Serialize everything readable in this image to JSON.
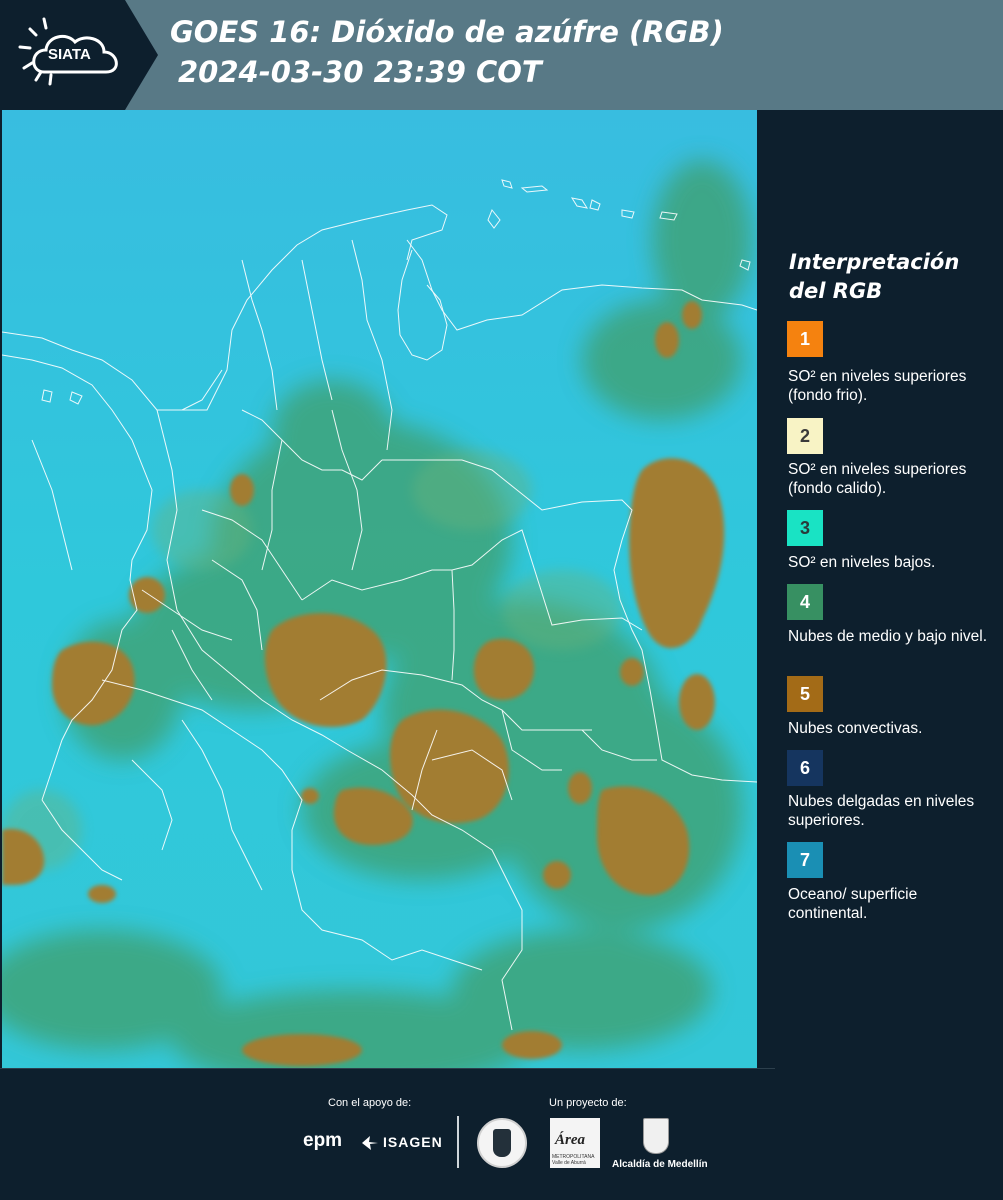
{
  "header": {
    "logo_text": "SIATA",
    "title": "GOES 16: Dióxido de azúfre (RGB)",
    "subtitle": "2024-03-30 23:39 COT"
  },
  "legend": {
    "title": "Interpretación del RGB",
    "items": [
      {
        "number": "1",
        "label": "SO² en niveles superiores (fondo frio).",
        "color": "#f5820f",
        "text_color": "#ffffff"
      },
      {
        "number": "2",
        "label": "SO² en niveles superiores (fondo calido).",
        "color": "#f8f3c5",
        "text_color": "#3a3a3a"
      },
      {
        "number": "3",
        "label": "SO² en niveles bajos.",
        "color": "#19e3c4",
        "text_color": "#2a3a3a"
      },
      {
        "number": "4",
        "label": "Nubes de medio y bajo nivel.",
        "color": "#379062",
        "text_color": "#ffffff"
      },
      {
        "number": "5",
        "label": "Nubes convectivas.",
        "color": "#a36b17",
        "text_color": "#ffffff"
      },
      {
        "number": "6",
        "label": "Nubes delgadas en niveles superiores.",
        "color": "#15355f",
        "text_color": "#ffffff"
      },
      {
        "number": "7",
        "label": "Oceano/ superficie continental.",
        "color": "#1a8fb4",
        "text_color": "#ffffff"
      }
    ]
  },
  "footer": {
    "support_label": "Con el apoyo de:",
    "support_logos": [
      "epm",
      "ISAGEN"
    ],
    "project_label": "Un proyecto de:",
    "area_logo_text": "Área",
    "area_logo_subtext": "METROPOLITANA Valle de Aburrá",
    "alcaldia_name": "Alcaldía de Medellín"
  },
  "map": {
    "background_color": "#31c7dc",
    "cloud_color": "#a27d33",
    "low_cloud_color": "#3a9b6a",
    "border_color": "#ffffff"
  }
}
